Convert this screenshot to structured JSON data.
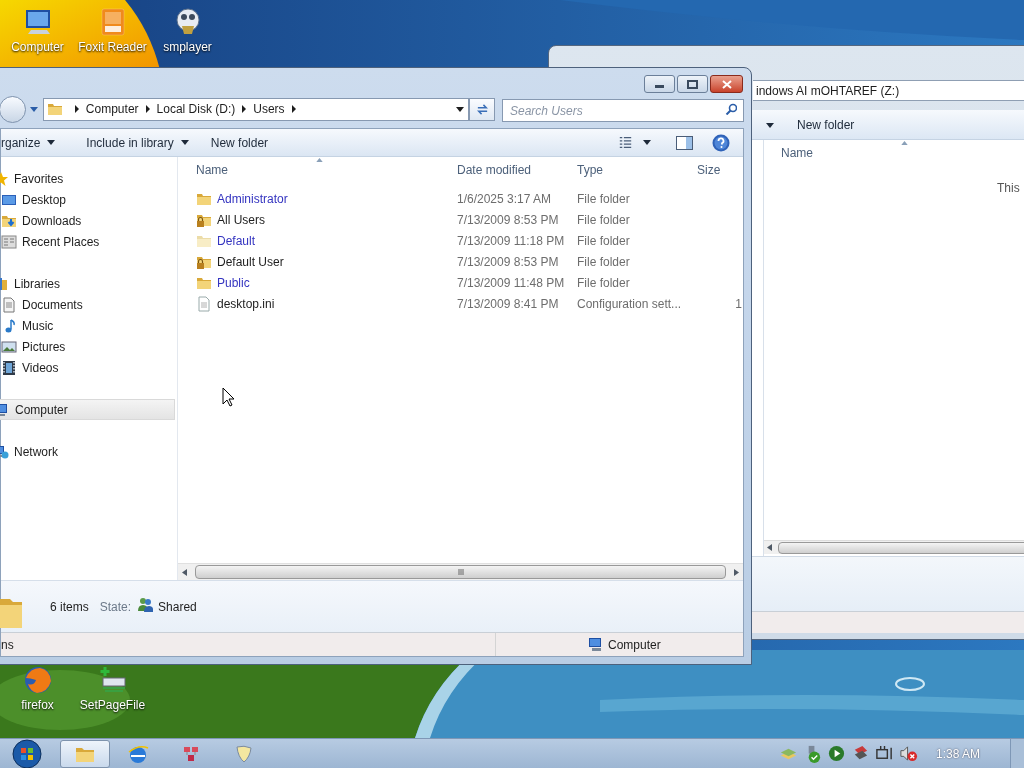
{
  "desktop": {
    "top_icons": [
      {
        "label": "Computer",
        "kind": "computer"
      },
      {
        "label": "Foxit Reader",
        "kind": "pdf"
      },
      {
        "label": "smplayer",
        "kind": "player"
      }
    ],
    "bottom_icons": [
      {
        "label": "firefox",
        "kind": "browser"
      },
      {
        "label": "SetPageFile",
        "kind": "drive"
      }
    ]
  },
  "back_window": {
    "address": "indows AI mOHTAREF (Z:)",
    "toolbar": [
      "New folder"
    ],
    "column": "Name",
    "message": "This"
  },
  "explorer": {
    "breadcrumb": [
      "Computer",
      "Local Disk (D:)",
      "Users"
    ],
    "search": {
      "placeholder": "Search Users"
    },
    "toolbar": [
      {
        "label": "rganize",
        "menu": true
      },
      {
        "label": "Include in library",
        "menu": true
      },
      {
        "label": "New folder",
        "menu": false
      }
    ],
    "nav": [
      {
        "label": "Favorites",
        "kind": "star",
        "selected": false,
        "children": [
          {
            "label": "Desktop",
            "kind": "desktop",
            "selected": false
          },
          {
            "label": "Downloads",
            "kind": "downloads",
            "selected": false
          },
          {
            "label": "Recent Places",
            "kind": "recent",
            "selected": false
          }
        ]
      },
      {
        "label": "Libraries",
        "kind": "library",
        "selected": false,
        "children": [
          {
            "label": "Documents",
            "kind": "documents",
            "selected": false
          },
          {
            "label": "Music",
            "kind": "music",
            "selected": false
          },
          {
            "label": "Pictures",
            "kind": "pictures",
            "selected": false
          },
          {
            "label": "Videos",
            "kind": "videos",
            "selected": false
          }
        ]
      },
      {
        "label": "Computer",
        "kind": "computer",
        "selected": true
      },
      {
        "label": "Network",
        "kind": "network",
        "selected": false
      }
    ],
    "columns": [
      "Name",
      "Date modified",
      "Type",
      "Size"
    ],
    "files": [
      {
        "name": "Administrator",
        "date": "1/6/2025 3:17 AM",
        "type": "File folder",
        "kind": "folder",
        "compressed": true
      },
      {
        "name": "All Users",
        "date": "7/13/2009 8:53 PM",
        "type": "File folder",
        "kind": "locked",
        "compressed": false
      },
      {
        "name": "Default",
        "date": "7/13/2009 11:18 PM",
        "type": "File folder",
        "kind": "hidden",
        "compressed": true
      },
      {
        "name": "Default User",
        "date": "7/13/2009 8:53 PM",
        "type": "File folder",
        "kind": "locked",
        "compressed": false
      },
      {
        "name": "Public",
        "date": "7/13/2009 11:48 PM",
        "type": "File folder",
        "kind": "folder",
        "compressed": true
      },
      {
        "name": "desktop.ini",
        "date": "7/13/2009 8:41 PM",
        "type": "Configuration sett...",
        "size": "1",
        "kind": "file",
        "compressed": false
      }
    ],
    "details": {
      "count": "6 items",
      "state_label": "State:",
      "state": "Shared"
    },
    "status_bar": {
      "left": "ns",
      "right": "Computer"
    }
  },
  "taskbar": {
    "apps": [
      {
        "kind": "folder",
        "selected": true
      },
      {
        "kind": "globe",
        "selected": false
      },
      {
        "kind": "grid",
        "selected": false
      },
      {
        "kind": "shield",
        "selected": false
      }
    ],
    "clock": "1:38 AM"
  }
}
